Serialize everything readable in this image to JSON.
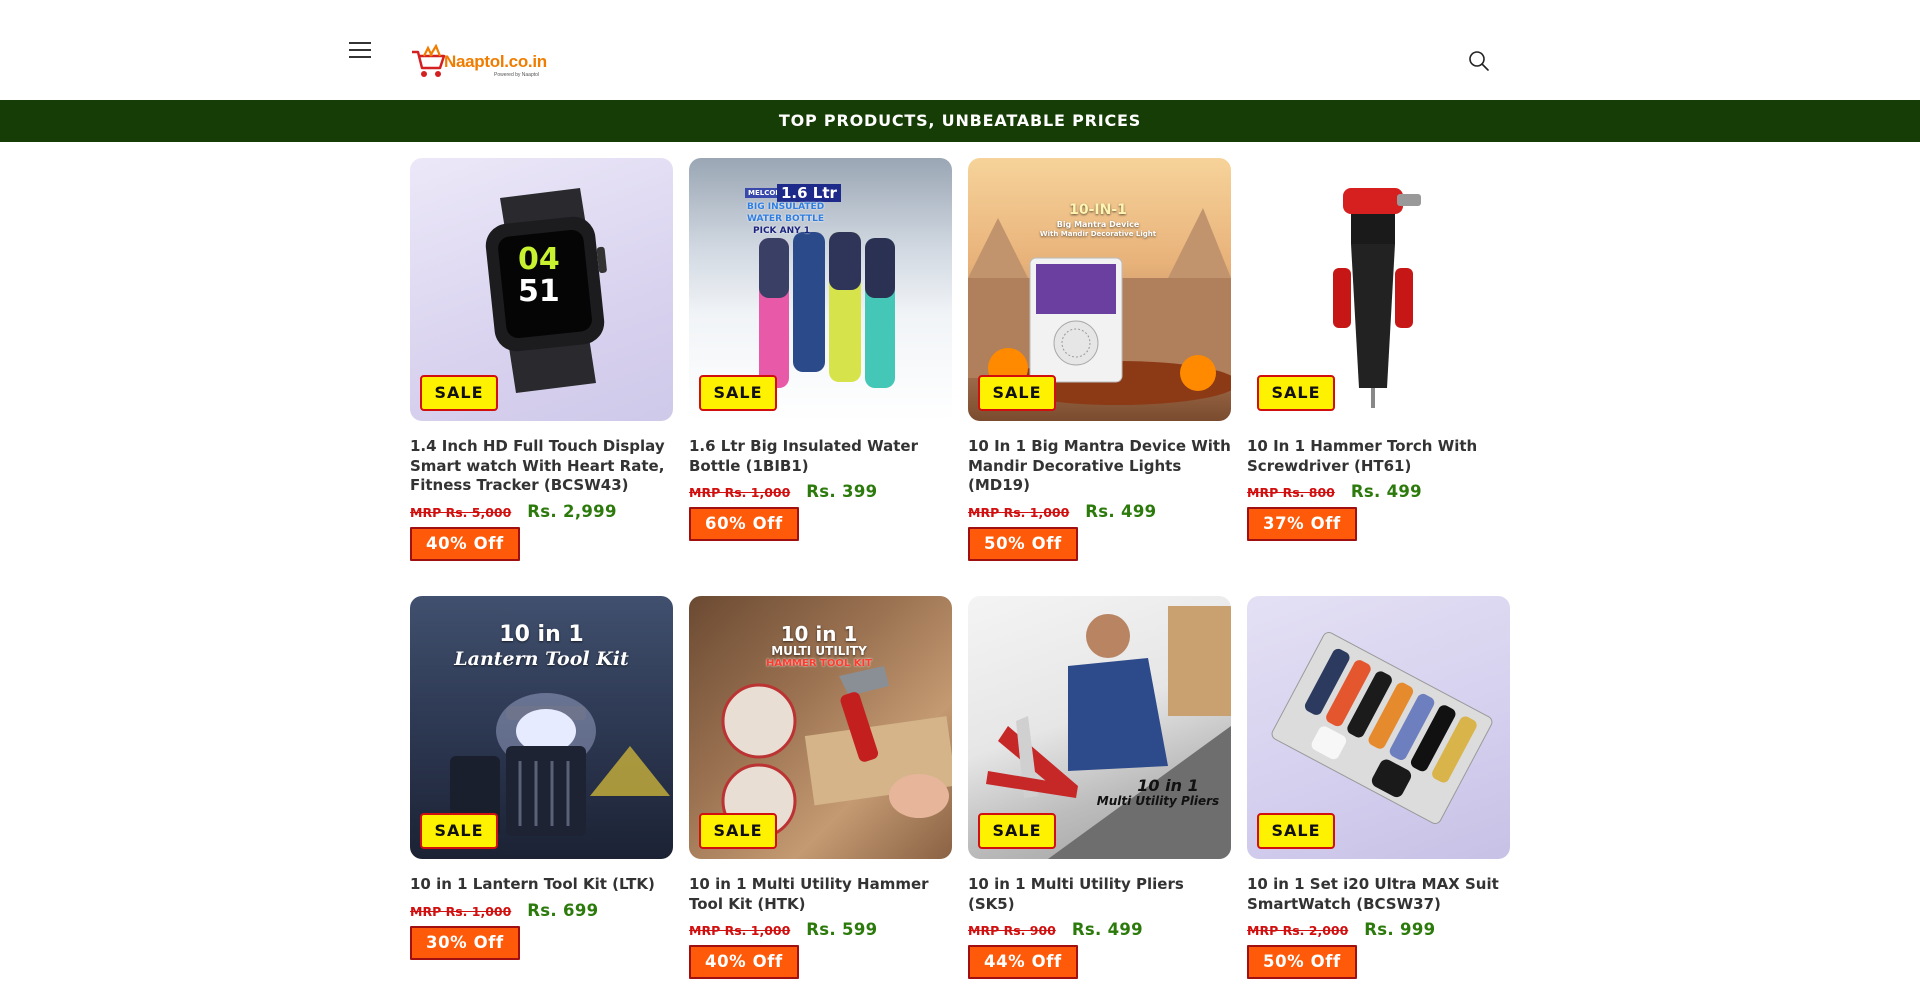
{
  "header": {
    "logo_text": "Naaptol.co.in",
    "logo_sub": "Powered by Naaptol",
    "menu_icon": "hamburger-icon",
    "search_icon": "search-icon"
  },
  "announcement": "TOP PRODUCTS, UNBEATABLE PRICES",
  "colors": {
    "announcement_bg": "#173d07",
    "sale_badge_bg": "#fff200",
    "sale_badge_border": "#d10f0f",
    "discount_bg": "#ff5a0a",
    "price_green": "#2b7a0b",
    "mrp_red": "#d10f0f"
  },
  "products": [
    {
      "badge": "SALE",
      "title": "1.4 Inch HD Full Touch Display Smart watch With Heart Rate, Fitness Tracker (BCSW43)",
      "mrp": "MRP Rs. 5,000",
      "price": "Rs. 2,999",
      "discount": "40% Off",
      "image_text": {
        "time_h": "04",
        "time_m": "51"
      }
    },
    {
      "badge": "SALE",
      "title": "1.6 Ltr Big Insulated Water Bottle (1BIB1)",
      "mrp": "MRP Rs. 1,000",
      "price": "Rs. 399",
      "discount": "60% Off",
      "image_text": {
        "line1": "1.6 Ltr",
        "line2": "BIG INSULATED",
        "line3": "WATER BOTTLE",
        "line4": "PICK ANY 1",
        "brand": "MELCOM"
      }
    },
    {
      "badge": "SALE",
      "title": "10 In 1 Big Mantra Device With Mandir Decorative Lights (MD19)",
      "mrp": "MRP Rs. 1,000",
      "price": "Rs. 499",
      "discount": "50% Off",
      "image_text": {
        "line1": "10-IN-1",
        "line2": "Big Mantra Device",
        "line3": "With Mandir Decorative Light"
      }
    },
    {
      "badge": "SALE",
      "title": "10 In 1 Hammer Torch With Screwdriver (HT61)",
      "mrp": "MRP Rs. 800",
      "price": "Rs. 499",
      "discount": "37% Off"
    },
    {
      "badge": "SALE",
      "title": "10 in 1 Lantern Tool Kit (LTK)",
      "mrp": "MRP Rs. 1,000",
      "price": "Rs. 699",
      "discount": "30% Off",
      "image_text": {
        "line1": "10 in 1",
        "line2": "Lantern Tool Kit"
      }
    },
    {
      "badge": "SALE",
      "title": "10 in 1 Multi Utility Hammer Tool Kit (HTK)",
      "mrp": "MRP Rs. 1,000",
      "price": "Rs. 599",
      "discount": "40% Off",
      "image_text": {
        "line1": "10 in 1",
        "line2": "MULTI UTILITY",
        "line3": "HAMMER TOOL KIT"
      }
    },
    {
      "badge": "SALE",
      "title": "10 in 1 Multi Utility Pliers (SK5)",
      "mrp": "MRP Rs. 900",
      "price": "Rs. 499",
      "discount": "44% Off",
      "image_text": {
        "line1": "10 in 1",
        "line2": "Multi Utility Pliers"
      }
    },
    {
      "badge": "SALE",
      "title": "10 in 1 Set i20 Ultra MAX Suit SmartWatch (BCSW37)",
      "mrp": "MRP Rs. 2,000",
      "price": "Rs. 999",
      "discount": "50% Off"
    }
  ]
}
